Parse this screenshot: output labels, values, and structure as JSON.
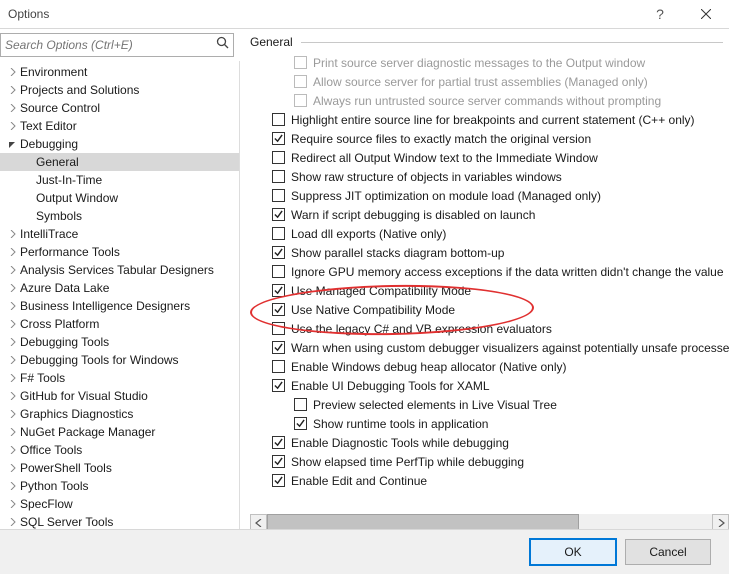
{
  "window": {
    "title": "Options"
  },
  "search": {
    "placeholder": "Search Options (Ctrl+E)"
  },
  "buttons": {
    "ok": "OK",
    "cancel": "Cancel"
  },
  "section": {
    "title": "General"
  },
  "tree": [
    {
      "label": "Environment",
      "depth": 0,
      "arrow": "collapsed"
    },
    {
      "label": "Projects and Solutions",
      "depth": 0,
      "arrow": "collapsed"
    },
    {
      "label": "Source Control",
      "depth": 0,
      "arrow": "collapsed"
    },
    {
      "label": "Text Editor",
      "depth": 0,
      "arrow": "collapsed"
    },
    {
      "label": "Debugging",
      "depth": 0,
      "arrow": "expanded"
    },
    {
      "label": "General",
      "depth": 1,
      "arrow": "none",
      "selected": true
    },
    {
      "label": "Just-In-Time",
      "depth": 1,
      "arrow": "none"
    },
    {
      "label": "Output Window",
      "depth": 1,
      "arrow": "none"
    },
    {
      "label": "Symbols",
      "depth": 1,
      "arrow": "none"
    },
    {
      "label": "IntelliTrace",
      "depth": 0,
      "arrow": "collapsed"
    },
    {
      "label": "Performance Tools",
      "depth": 0,
      "arrow": "collapsed"
    },
    {
      "label": "Analysis Services Tabular Designers",
      "depth": 0,
      "arrow": "collapsed"
    },
    {
      "label": "Azure Data Lake",
      "depth": 0,
      "arrow": "collapsed"
    },
    {
      "label": "Business Intelligence Designers",
      "depth": 0,
      "arrow": "collapsed"
    },
    {
      "label": "Cross Platform",
      "depth": 0,
      "arrow": "collapsed"
    },
    {
      "label": "Debugging Tools",
      "depth": 0,
      "arrow": "collapsed"
    },
    {
      "label": "Debugging Tools for Windows",
      "depth": 0,
      "arrow": "collapsed"
    },
    {
      "label": "F# Tools",
      "depth": 0,
      "arrow": "collapsed"
    },
    {
      "label": "GitHub for Visual Studio",
      "depth": 0,
      "arrow": "collapsed"
    },
    {
      "label": "Graphics Diagnostics",
      "depth": 0,
      "arrow": "collapsed"
    },
    {
      "label": "NuGet Package Manager",
      "depth": 0,
      "arrow": "collapsed"
    },
    {
      "label": "Office Tools",
      "depth": 0,
      "arrow": "collapsed"
    },
    {
      "label": "PowerShell Tools",
      "depth": 0,
      "arrow": "collapsed"
    },
    {
      "label": "Python Tools",
      "depth": 0,
      "arrow": "collapsed"
    },
    {
      "label": "SpecFlow",
      "depth": 0,
      "arrow": "collapsed"
    },
    {
      "label": "SQL Server Tools",
      "depth": 0,
      "arrow": "collapsed"
    }
  ],
  "options": [
    {
      "label": "Print source server diagnostic messages to the Output window",
      "checked": false,
      "disabled": true,
      "indent": 2
    },
    {
      "label": "Allow source server for partial trust assemblies (Managed only)",
      "checked": false,
      "disabled": true,
      "indent": 2
    },
    {
      "label": "Always run untrusted source server commands without prompting",
      "checked": false,
      "disabled": true,
      "indent": 2
    },
    {
      "label": "Highlight entire source line for breakpoints and current statement (C++ only)",
      "checked": false,
      "indent": 1
    },
    {
      "label": "Require source files to exactly match the original version",
      "checked": true,
      "indent": 1
    },
    {
      "label": "Redirect all Output Window text to the Immediate Window",
      "checked": false,
      "indent": 1
    },
    {
      "label": "Show raw structure of objects in variables windows",
      "checked": false,
      "indent": 1
    },
    {
      "label": "Suppress JIT optimization on module load (Managed only)",
      "checked": false,
      "indent": 1
    },
    {
      "label": "Warn if script debugging is disabled on launch",
      "checked": true,
      "indent": 1
    },
    {
      "label": "Load dll exports (Native only)",
      "checked": false,
      "indent": 1
    },
    {
      "label": "Show parallel stacks diagram bottom-up",
      "checked": true,
      "indent": 1
    },
    {
      "label": "Ignore GPU memory access exceptions if the data written didn't change the value",
      "checked": false,
      "indent": 1
    },
    {
      "label": "Use Managed Compatibility Mode",
      "checked": true,
      "indent": 1,
      "highlighted": true
    },
    {
      "label": "Use Native Compatibility Mode",
      "checked": true,
      "indent": 1,
      "highlighted": true
    },
    {
      "label": "Use the legacy C# and VB expression evaluators",
      "checked": false,
      "indent": 1
    },
    {
      "label": "Warn when using custom debugger visualizers against potentially unsafe processes",
      "checked": true,
      "indent": 1
    },
    {
      "label": "Enable Windows debug heap allocator (Native only)",
      "checked": false,
      "indent": 1
    },
    {
      "label": "Enable UI Debugging Tools for XAML",
      "checked": true,
      "indent": 1
    },
    {
      "label": "Preview selected elements in Live Visual Tree",
      "checked": false,
      "indent": 2
    },
    {
      "label": "Show runtime tools in application",
      "checked": true,
      "indent": 2
    },
    {
      "label": "Enable Diagnostic Tools while debugging",
      "checked": true,
      "indent": 1
    },
    {
      "label": "Show elapsed time PerfTip while debugging",
      "checked": true,
      "indent": 1
    },
    {
      "label": "Enable Edit and Continue",
      "checked": true,
      "indent": 1
    }
  ]
}
